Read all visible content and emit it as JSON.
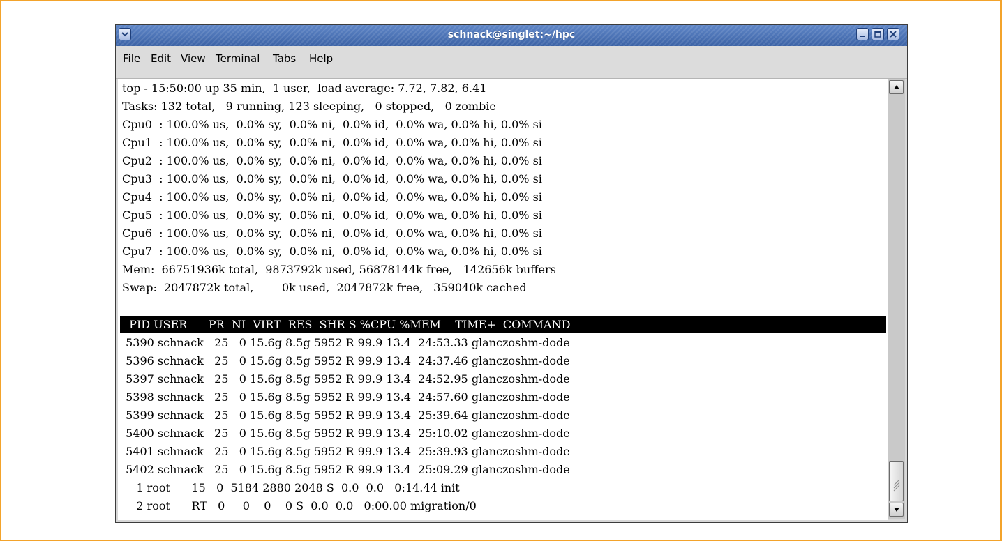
{
  "window": {
    "title": "schnack@singlet:~/hpc"
  },
  "menu": {
    "items": [
      {
        "mnemonic": "F",
        "rest": "ile"
      },
      {
        "mnemonic": "E",
        "rest": "dit"
      },
      {
        "mnemonic": "V",
        "rest": "iew"
      },
      {
        "mnemonic": "T",
        "rest": "erminal"
      },
      {
        "before": "Ta",
        "mnemonic": "b",
        "rest": "s"
      },
      {
        "mnemonic": "H",
        "rest": "elp"
      }
    ]
  },
  "terminal": {
    "summary": [
      "top - 15:50:00 up 35 min,  1 user,  load average: 7.72, 7.82, 6.41",
      "Tasks: 132 total,   9 running, 123 sleeping,   0 stopped,   0 zombie",
      "Cpu0  : 100.0% us,  0.0% sy,  0.0% ni,  0.0% id,  0.0% wa, 0.0% hi, 0.0% si",
      "Cpu1  : 100.0% us,  0.0% sy,  0.0% ni,  0.0% id,  0.0% wa, 0.0% hi, 0.0% si",
      "Cpu2  : 100.0% us,  0.0% sy,  0.0% ni,  0.0% id,  0.0% wa, 0.0% hi, 0.0% si",
      "Cpu3  : 100.0% us,  0.0% sy,  0.0% ni,  0.0% id,  0.0% wa, 0.0% hi, 0.0% si",
      "Cpu4  : 100.0% us,  0.0% sy,  0.0% ni,  0.0% id,  0.0% wa, 0.0% hi, 0.0% si",
      "Cpu5  : 100.0% us,  0.0% sy,  0.0% ni,  0.0% id,  0.0% wa, 0.0% hi, 0.0% si",
      "Cpu6  : 100.0% us,  0.0% sy,  0.0% ni,  0.0% id,  0.0% wa, 0.0% hi, 0.0% si",
      "Cpu7  : 100.0% us,  0.0% sy,  0.0% ni,  0.0% id,  0.0% wa, 0.0% hi, 0.0% si",
      "Mem:  66751936k total,  9873792k used, 56878144k free,   142656k buffers",
      "Swap:  2047872k total,        0k used,  2047872k free,   359040k cached"
    ],
    "table_header": "  PID USER      PR  NI  VIRT  RES  SHR S %CPU %MEM    TIME+  COMMAND",
    "processes": [
      " 5390 schnack   25   0 15.6g 8.5g 5952 R 99.9 13.4  24:53.33 glanczoshm-dode",
      " 5396 schnack   25   0 15.6g 8.5g 5952 R 99.9 13.4  24:37.46 glanczoshm-dode",
      " 5397 schnack   25   0 15.6g 8.5g 5952 R 99.9 13.4  24:52.95 glanczoshm-dode",
      " 5398 schnack   25   0 15.6g 8.5g 5952 R 99.9 13.4  24:57.60 glanczoshm-dode",
      " 5399 schnack   25   0 15.6g 8.5g 5952 R 99.9 13.4  25:39.64 glanczoshm-dode",
      " 5400 schnack   25   0 15.6g 8.5g 5952 R 99.9 13.4  25:10.02 glanczoshm-dode",
      " 5401 schnack   25   0 15.6g 8.5g 5952 R 99.9 13.4  25:39.93 glanczoshm-dode",
      " 5402 schnack   25   0 15.6g 8.5g 5952 R 99.9 13.4  25:09.29 glanczoshm-dode",
      "    1 root      15   0  5184 2880 2048 S  0.0  0.0   0:14.44 init",
      "    2 root      RT   0     0    0    0 S  0.0  0.0   0:00.00 migration/0"
    ]
  },
  "colors": {
    "frame": "#f3a32b",
    "titlebar": "#4a70b5",
    "terminal_bg": "#ffffff",
    "header_bg": "#000000"
  }
}
